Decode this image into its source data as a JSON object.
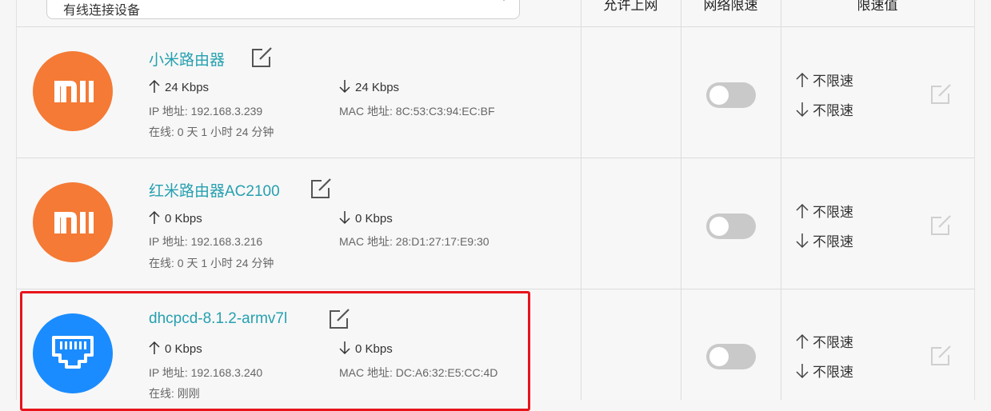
{
  "filter": {
    "selected": "有线连接设备"
  },
  "headers": {
    "allow": "允许上网",
    "speed_limit_toggle": "网络限速",
    "limit_value": "限速值"
  },
  "devices": [
    {
      "name": "小米路由器",
      "icon": "xiaomi-logo-icon",
      "up": "24 Kbps",
      "down": "24 Kbps",
      "ip": "IP 地址: 192.168.3.239",
      "mac": "MAC 地址: 8C:53:C3:94:EC:BF",
      "online": "在线: 0 天 1 小时 24 分钟",
      "limit_on": false,
      "up_limit": "不限速",
      "down_limit": "不限速"
    },
    {
      "name": "红米路由器AC2100",
      "icon": "xiaomi-logo-icon",
      "up": "0 Kbps",
      "down": "0 Kbps",
      "ip": "IP 地址: 192.168.3.216",
      "mac": "MAC 地址: 28:D1:27:17:E9:30",
      "online": "在线: 0 天 1 小时 24 分钟",
      "limit_on": false,
      "up_limit": "不限速",
      "down_limit": "不限速"
    },
    {
      "name": "dhcpcd-8.1.2-armv7l",
      "icon": "ethernet-port-icon",
      "up": "0 Kbps",
      "down": "0 Kbps",
      "ip": "IP 地址: 192.168.3.240",
      "mac": "MAC 地址: DC:A6:32:E5:CC:4D",
      "online": "在线: 刚刚",
      "limit_on": false,
      "up_limit": "不限速",
      "down_limit": "不限速"
    }
  ],
  "colors": {
    "xiaomi_orange": "#f47a35",
    "lan_blue": "#1a8cff",
    "name_teal": "#26a0b0",
    "highlight_red": "#e8131b",
    "toggle_off": "#c9c9c9"
  }
}
